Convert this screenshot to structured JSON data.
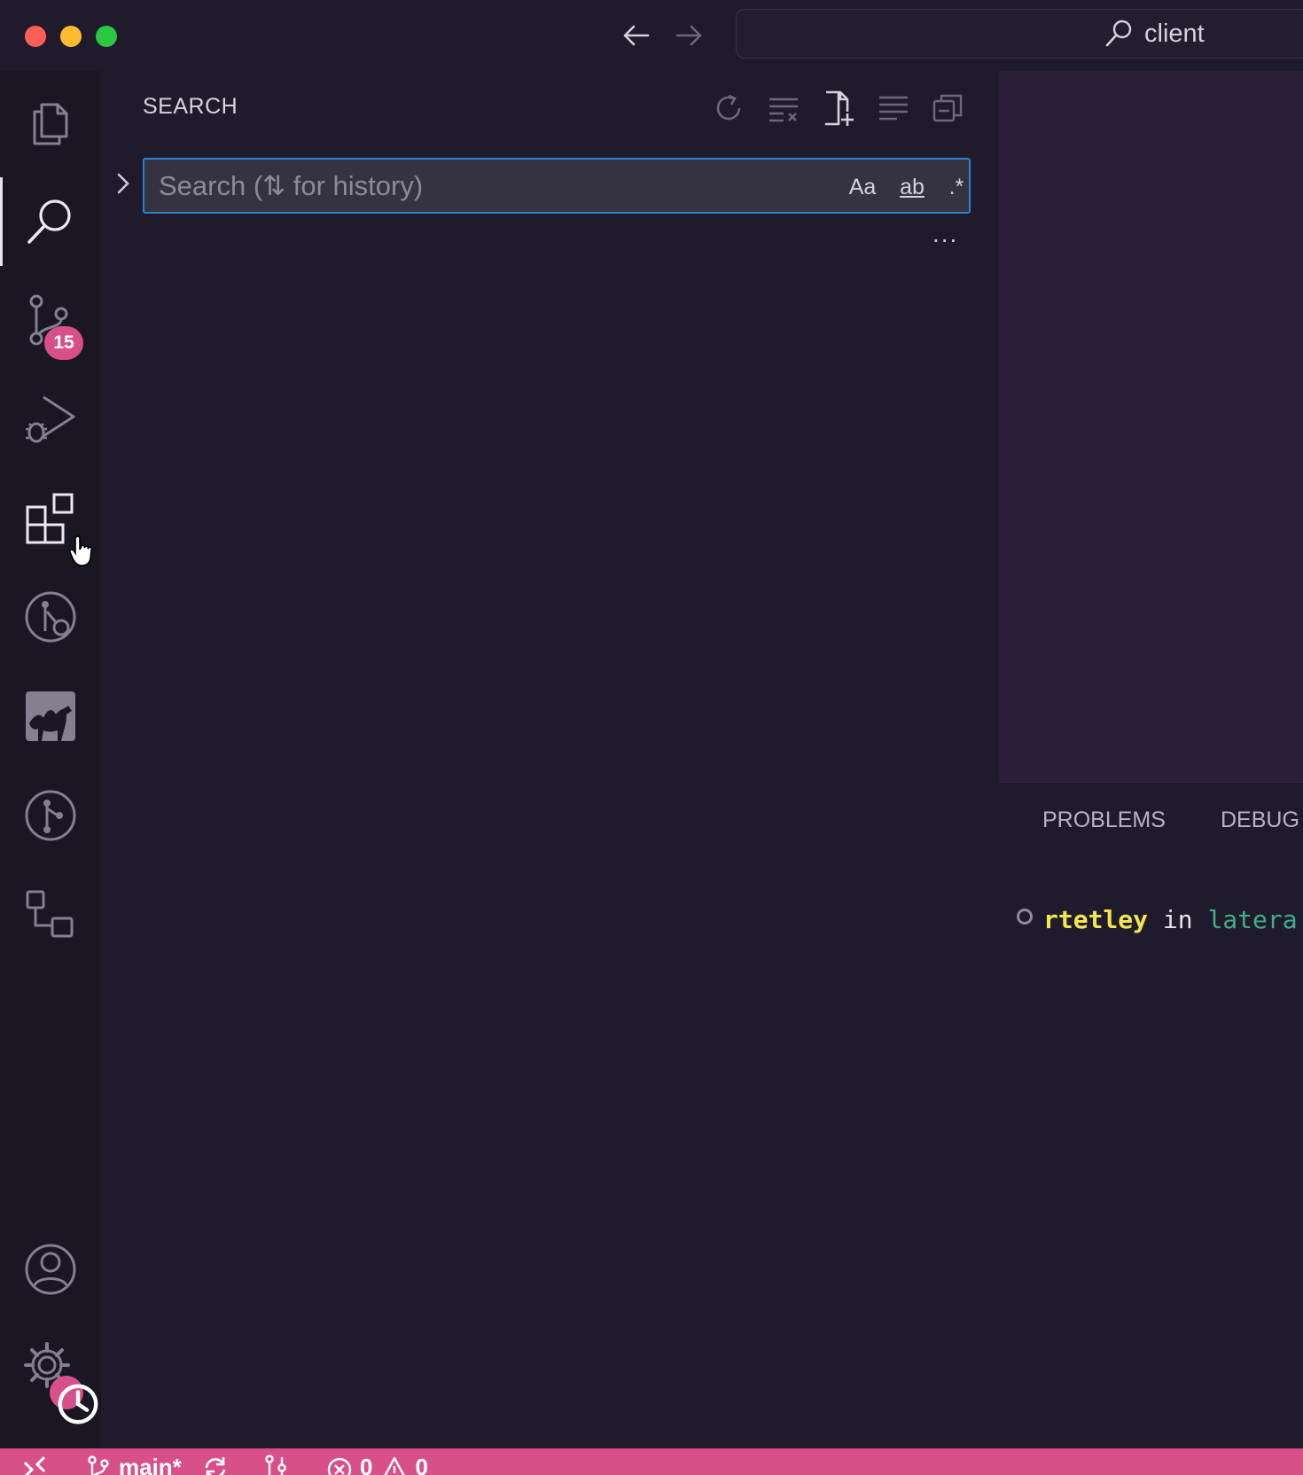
{
  "titlebar": {
    "command_center_text": "client"
  },
  "activity_bar": {
    "source_control_badge": "15"
  },
  "sidebar": {
    "title": "SEARCH",
    "search": {
      "placeholder": "Search (⇅ for history)",
      "match_case_label": "Aa",
      "match_word_label": "ab",
      "regex_label": ".*"
    },
    "more_label": "..."
  },
  "panel": {
    "tabs": [
      "PROBLEMS",
      "DEBUG"
    ],
    "terminal": {
      "user": "rtetley",
      "in": "in",
      "dir": "latera"
    }
  },
  "status_bar": {
    "branch": "main*",
    "errors": "0",
    "warnings": "0"
  },
  "colors": {
    "accent": "#d8508a",
    "focus_border": "#2f80d1",
    "background": "#1c1827"
  }
}
